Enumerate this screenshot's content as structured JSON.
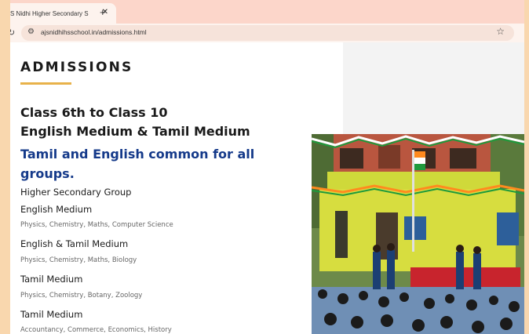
{
  "browser": {
    "tab_title": "S Nidhi Higher Secondary S",
    "url": "ajsnidhihsschool.in/admissions.html"
  },
  "content": {
    "heading": "ADMISSIONS",
    "class_range": "Class 6th to Class 10",
    "mediums": "English Medium & Tamil Medium",
    "common_note": "Tamil and English common for all groups.",
    "hs_group_label": "Higher Secondary Group",
    "groups": [
      {
        "name": "English Medium",
        "subjects": "Physics, Chemistry, Maths, Computer Science"
      },
      {
        "name": "English & Tamil Medium",
        "subjects": "Physics, Chemistry, Maths, Biology"
      },
      {
        "name": "Tamil Medium",
        "subjects": "Physics, Chemistry, Botany, Zoology"
      },
      {
        "name": "Tamil Medium",
        "subjects": "Accountancy, Commerce, Economics, History"
      }
    ]
  },
  "colors": {
    "accent_underline": "#e8b24a",
    "highlight_text": "#153a8a",
    "tab_strip": "#fcd6ca"
  },
  "icons": {
    "reload": "reload-icon",
    "site_settings": "tune-icon",
    "bookmark": "star-icon",
    "close": "close-icon",
    "new_tab": "plus-icon"
  }
}
